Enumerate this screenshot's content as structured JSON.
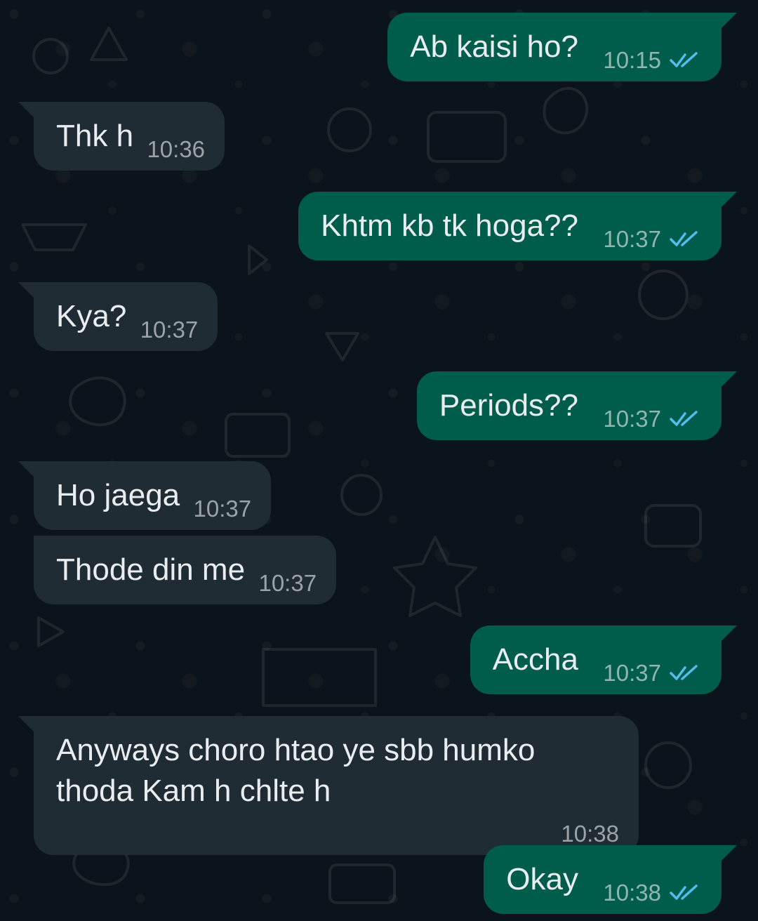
{
  "messages": [
    {
      "direction": "out",
      "text": "Ab kaisi ho?",
      "time": "10:15",
      "status": "read"
    },
    {
      "direction": "in",
      "text": "Thk h",
      "time": "10:36"
    },
    {
      "direction": "out",
      "text": "Khtm kb tk hoga??",
      "time": "10:37",
      "status": "read"
    },
    {
      "direction": "in",
      "text": "Kya?",
      "time": "10:37"
    },
    {
      "direction": "out",
      "text": "Periods??",
      "time": "10:37",
      "status": "read"
    },
    {
      "direction": "in",
      "text": "Ho jaega",
      "time": "10:37"
    },
    {
      "direction": "in",
      "text": "Thode din me",
      "time": "10:37"
    },
    {
      "direction": "out",
      "text": "Accha",
      "time": "10:37",
      "status": "read"
    },
    {
      "direction": "in",
      "text": "Anyways choro htao ye sbb humko\nthoda Kam h chlte h",
      "time": "10:38"
    },
    {
      "direction": "out",
      "text": "Okay",
      "time": "10:38",
      "status": "read"
    }
  ],
  "colors": {
    "background": "#0b141a",
    "incoming_bubble": "#202c33",
    "outgoing_bubble": "#005c4b",
    "text": "#e9edef",
    "read_tick": "#53bdeb"
  },
  "icons": {
    "read_receipt": "double-check-icon"
  }
}
